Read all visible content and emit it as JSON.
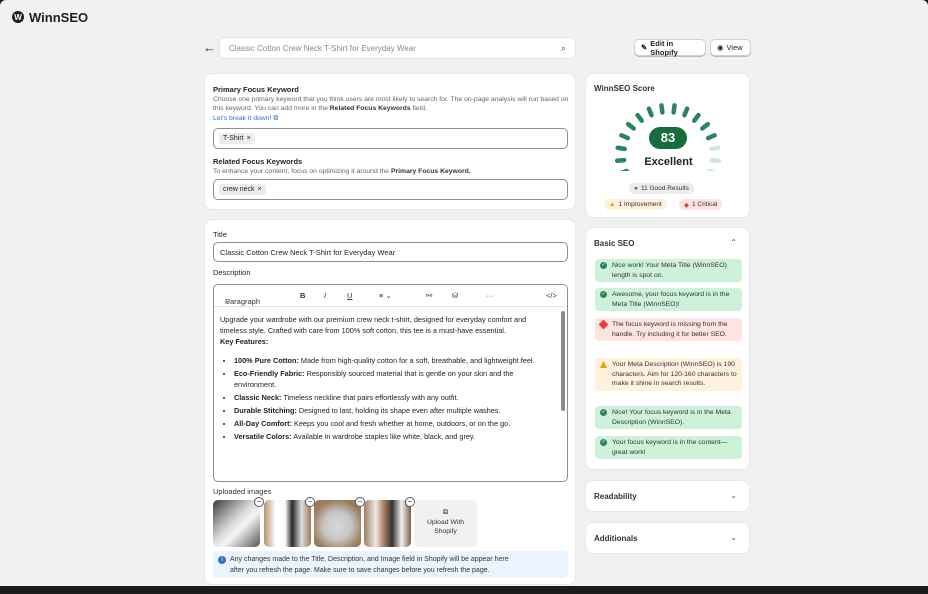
{
  "app": {
    "name": "WinnSEO",
    "logo_glyph": "W"
  },
  "header": {
    "back_icon": "arrow-left-icon",
    "search_value": "Classic Cotton Crew Neck T-Shirt for Everyday Wear",
    "edit_label": "Edit in Shopify",
    "view_label": "View"
  },
  "focus": {
    "primary_label": "Primary Focus Keyword",
    "primary_help_1": "Choose one primary keyword that you think users are most likely to search for. The on-page analysis will",
    "primary_help_2": "run based on this keyword. You can add more in the",
    "primary_help_bold": "Related Focus Keywords",
    "primary_help_3": "field.",
    "break_link": "Let's break it down!",
    "primary_chip": "T-Shirt",
    "related_label": "Related Focus Keywords",
    "related_help_1": "To enhance your content, focus on optimizing it around the",
    "related_help_bold": "Primary Focus Keyword.",
    "related_chip": "crew neck",
    "chip_remove": "×"
  },
  "editor": {
    "title_label": "Title",
    "title_value": "Classic Cotton Crew Neck T-Shirt for Everyday Wear",
    "desc_label": "Description",
    "toolbar": {
      "paragraph": "Paragraph",
      "bold": "B",
      "italic": "I",
      "underline": "U",
      "more": "···",
      "code": "</>"
    },
    "intro": "Upgrade your wardrobe with our premium crew neck t-shirt, designed for everyday comfort and timeless style. Crafted with care from 100% soft cotton, this tee is a must-have essential.",
    "features_heading": "Key Features:",
    "features": [
      {
        "name": "100% Pure Cotton:",
        "text": " Made from high-quality cotton for a soft, breathable, and lightweight feel."
      },
      {
        "name": "Eco-Friendly Fabric:",
        "text": " Responsibly sourced material that is gentle on your skin and the environment."
      },
      {
        "name": "Classic Neck:",
        "text": " Timeless neckline that pairs effortlessly with any outfit."
      },
      {
        "name": "Durable Stitching:",
        "text": " Designed to last, holding its shape even after multiple washes."
      },
      {
        "name": "All-Day Comfort:",
        "text": " Keeps you cool and fresh whether at home, outdoors, or on the go."
      },
      {
        "name": "Versatile Colors:",
        "text": " Available in wardrobe staples like white, black, and grey."
      }
    ]
  },
  "images": {
    "label": "Uploaded images",
    "remove_glyph": "−",
    "upload_label_1": "Upload With",
    "upload_label_2": "Shopify",
    "notice_1": "Any changes made to the Title, Description, and Image field in Shopify will be appear here",
    "notice_2": "after you refresh the page. Make sure to save changes before you refresh the page."
  },
  "score": {
    "title": "WinnSEO Score",
    "value": "83",
    "fraction": 0.83,
    "rating": "Excellent",
    "good": "11 Good Results",
    "improve": "1 Improvement",
    "critical": "1 Critical",
    "color": "#29845a"
  },
  "basic_seo": {
    "title": "Basic SEO",
    "items": [
      {
        "type": "good",
        "text": "Nice work! Your Meta Title (WinnSEO) length is spot on."
      },
      {
        "type": "good",
        "text": "Awesome, your focus keyword is in the Meta Title (WinnSEO)!"
      },
      {
        "type": "bad",
        "text": "The focus keyword is missing from the handle. Try including it for better SEO."
      },
      {
        "type": "warn",
        "text": "Your Meta Description (WinnSEO) is 190 characters. Aim for 120-160 characters to make it shine in search results."
      },
      {
        "type": "good",
        "text": "Nice! Your focus keyword is in the Meta Description (WinnSEO)."
      },
      {
        "type": "good",
        "text": "Your focus keyword is in the content—great work!"
      }
    ]
  },
  "readability": {
    "title": "Readability"
  },
  "additionals": {
    "title": "Additionals"
  }
}
